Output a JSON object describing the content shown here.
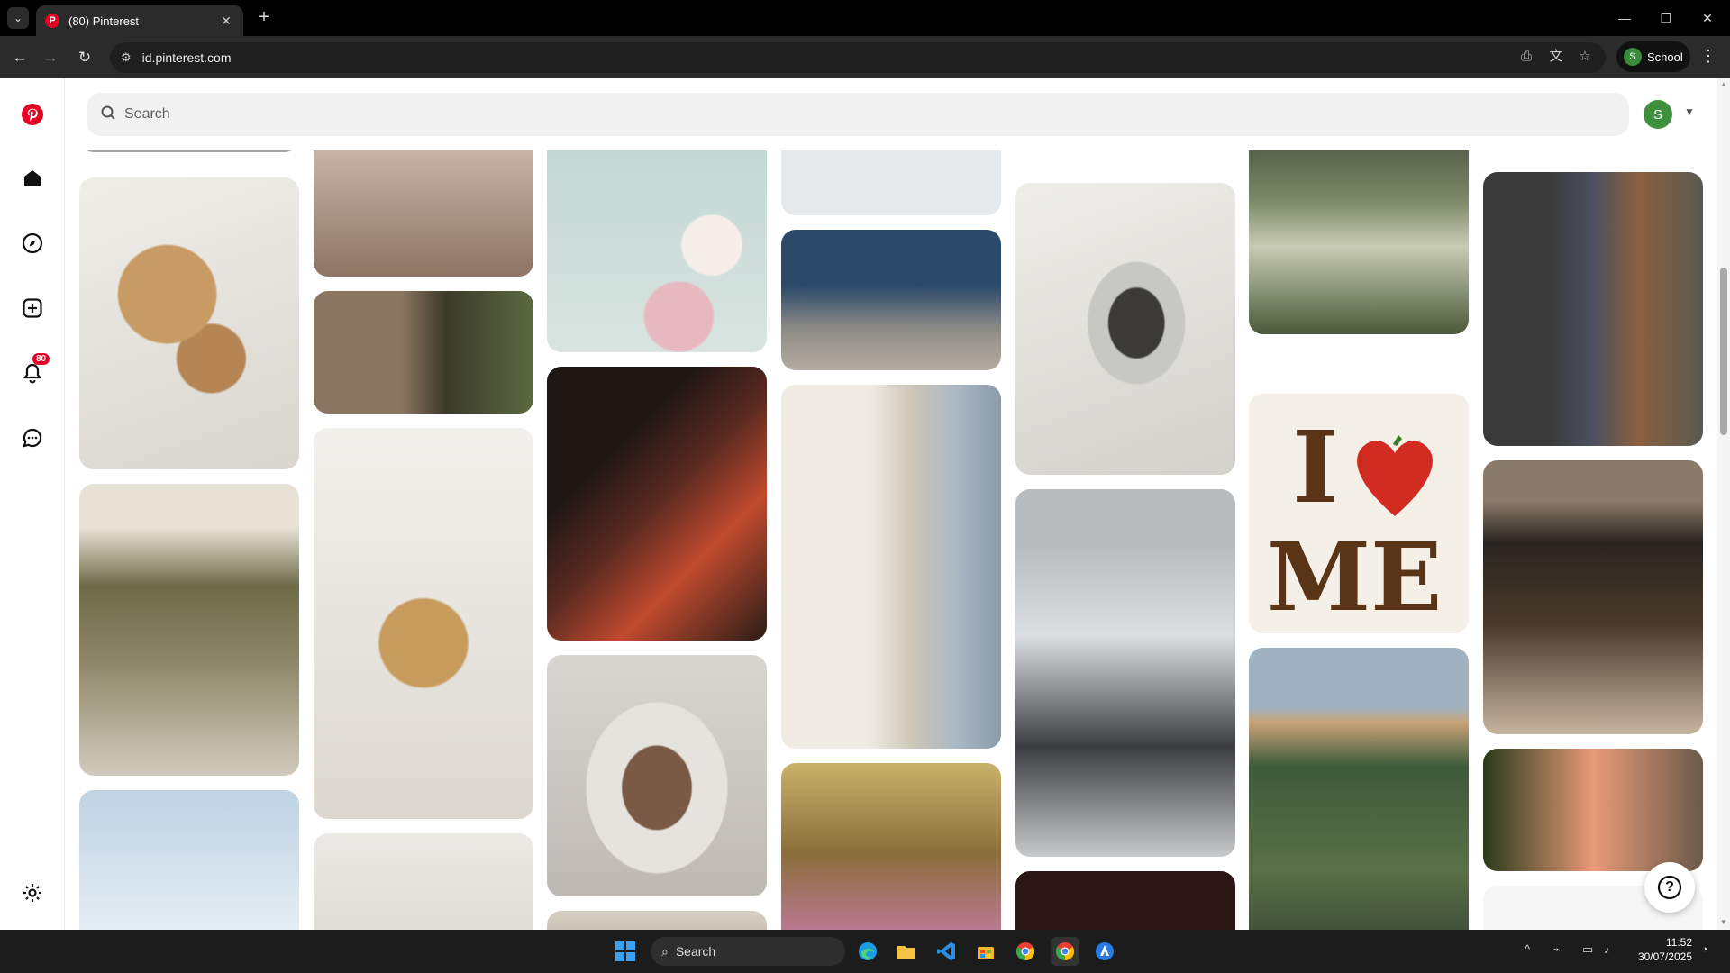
{
  "browser": {
    "tab_title": "(80) Pinterest",
    "favicon_letter": "P",
    "close_tab": "✕",
    "new_tab": "+",
    "url": "id.pinterest.com",
    "profile_initial": "S",
    "profile_name": "School",
    "window": {
      "minimize": "—",
      "restore": "❐",
      "close": "✕"
    }
  },
  "pinterest": {
    "search_placeholder": "Search",
    "avatar_initial": "S",
    "notification_count": "80",
    "help_label": "?",
    "brand_color": "#e60023"
  },
  "taskbar": {
    "search_label": "Search",
    "time": "11:52",
    "date": "30/07/2025"
  }
}
